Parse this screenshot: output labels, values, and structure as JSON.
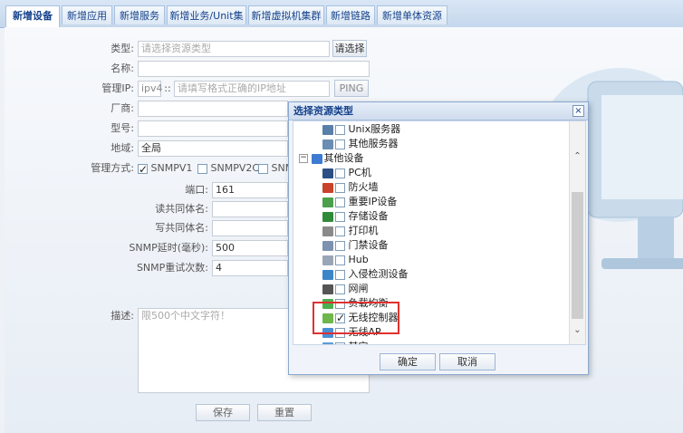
{
  "tabs": [
    "新增设备",
    "新增应用",
    "新增服务",
    "新增业务/Unit集",
    "新增虚拟机集群",
    "新增链路",
    "新增单体资源"
  ],
  "form": {
    "type_label": "类型:",
    "type_placeholder": "请选择资源类型",
    "select_button": "请选择",
    "name_label": "名称:",
    "ip_label": "管理IP:",
    "ip_version": "ipv4",
    "ip_sep": "::",
    "ip_placeholder": "请填写格式正确的IP地址",
    "ping_button": "PING",
    "vendor_label": "厂商:",
    "model_label": "型号:",
    "region_label": "地域:",
    "region_value": "全局",
    "mgmt_label": "管理方式:",
    "snmpv1": "SNMPV1",
    "snmpv2c": "SNMPV2C",
    "snmpv3_partial": "SNM",
    "port_label": "端口:",
    "port_value": "161",
    "read_comm_label": "读共同体名:",
    "write_comm_label": "写共同体名:",
    "timeout_label": "SNMP延时(毫秒):",
    "timeout_value": "500",
    "retry_label": "SNMP重试次数:",
    "retry_value": "4",
    "desc_label": "描述:",
    "desc_placeholder": "限500个中文字符！",
    "save_button": "保存",
    "reset_button": "重置"
  },
  "dialog": {
    "title": "选择资源类型",
    "close": "×",
    "items": [
      {
        "label": "Unix服务器",
        "checked": false
      },
      {
        "label": "其他服务器",
        "checked": false
      },
      {
        "label": "其他设备",
        "group": true
      },
      {
        "label": "PC机",
        "checked": false
      },
      {
        "label": "防火墙",
        "checked": false
      },
      {
        "label": "重要IP设备",
        "checked": false
      },
      {
        "label": "存储设备",
        "checked": false
      },
      {
        "label": "打印机",
        "checked": false
      },
      {
        "label": "门禁设备",
        "checked": false
      },
      {
        "label": "Hub",
        "checked": false
      },
      {
        "label": "入侵检测设备",
        "checked": false
      },
      {
        "label": "网闸",
        "checked": false
      },
      {
        "label": "负载均衡",
        "checked": false
      },
      {
        "label": "无线控制器",
        "checked": true
      },
      {
        "label": "无线AP",
        "checked": false
      },
      {
        "label": "其它",
        "checked": false
      }
    ],
    "ok_button": "确定",
    "cancel_button": "取消"
  }
}
